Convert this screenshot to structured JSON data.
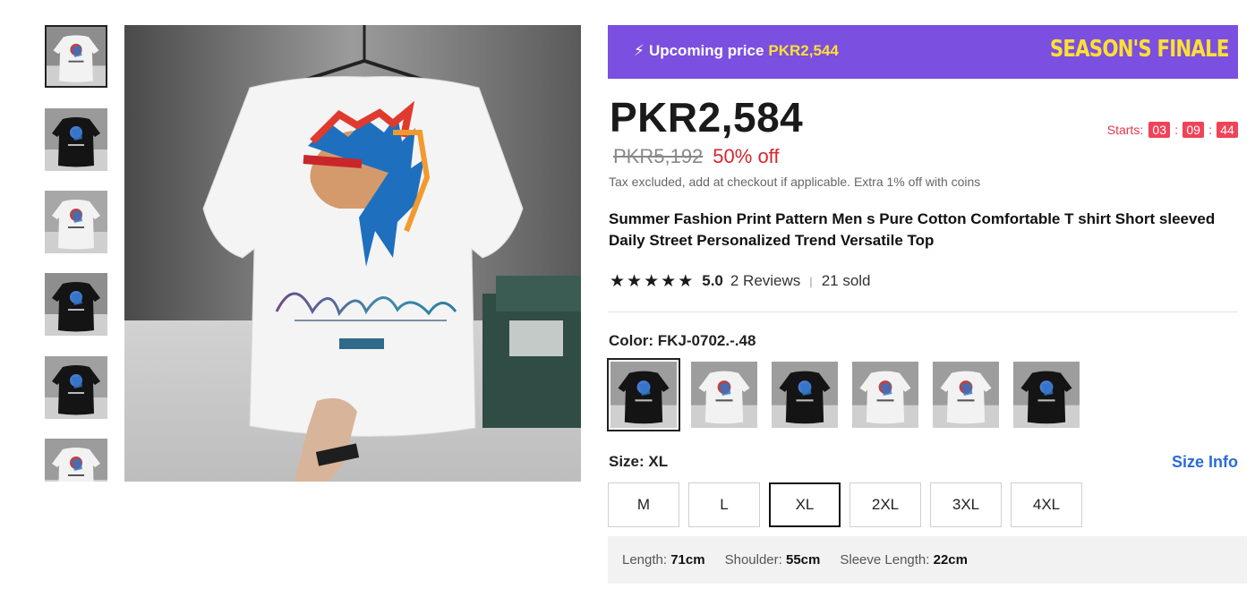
{
  "thumbnails": [
    {
      "alt": "white tee thumbnail 1",
      "shirt": "#f2f2f2",
      "bg": "#8d8d8d"
    },
    {
      "alt": "black tee thumbnail 2",
      "shirt": "#141414",
      "bg": "#9a9a9a"
    },
    {
      "alt": "white tee thumbnail 3",
      "shirt": "#f2f2f2",
      "bg": "#a7a7a7"
    },
    {
      "alt": "black tee thumbnail 4",
      "shirt": "#141414",
      "bg": "#8e8e8e"
    },
    {
      "alt": "black tee thumbnail 5",
      "shirt": "#141414",
      "bg": "#a0a0a0"
    },
    {
      "alt": "white tee thumbnail 6",
      "shirt": "#f2f2f2",
      "bg": "#9c9c9c"
    }
  ],
  "banner": {
    "icon": "lightning-icon",
    "label": "Upcoming price",
    "upcoming_price": "PKR2,544",
    "event": "SEASON'S FINALE",
    "bg_color": "#7b4fe0",
    "accent_color": "#ffe033"
  },
  "price": {
    "current": "PKR2,584",
    "original": "PKR5,192",
    "discount": "50% off",
    "tax_note": "Tax excluded, add at checkout if applicable. Extra 1% off with coins"
  },
  "countdown": {
    "label": "Starts:",
    "hours": "03",
    "minutes": "09",
    "seconds": "44",
    "separator": ":"
  },
  "product": {
    "title": "Summer Fashion Print Pattern Men s Pure Cotton Comfortable T shirt Short sleeved Daily Street Personalized Trend Versatile Top"
  },
  "rating": {
    "stars": 5,
    "score": "5.0",
    "reviews": "2 Reviews",
    "separator": "|",
    "sold": "21 sold"
  },
  "color": {
    "label": "Color:",
    "selected": "FKJ-0702.-.48",
    "options": [
      {
        "name": "black-blue-print",
        "shirt": "#141414"
      },
      {
        "name": "white-headdress-print",
        "shirt": "#f2f2f2"
      },
      {
        "name": "black-headdress-print",
        "shirt": "#141414"
      },
      {
        "name": "white-blue-print",
        "shirt": "#f2f2f2"
      },
      {
        "name": "white-dark-print",
        "shirt": "#f2f2f2"
      },
      {
        "name": "black-dark-print",
        "shirt": "#141414"
      }
    ]
  },
  "size": {
    "label": "Size:",
    "selected": "XL",
    "info_link": "Size Info",
    "options": [
      "M",
      "L",
      "XL",
      "2XL",
      "3XL",
      "4XL"
    ]
  },
  "measurements": [
    {
      "label": "Length:",
      "value": "71cm"
    },
    {
      "label": "Shoulder:",
      "value": "55cm"
    },
    {
      "label": "Sleeve Length:",
      "value": "22cm"
    }
  ]
}
